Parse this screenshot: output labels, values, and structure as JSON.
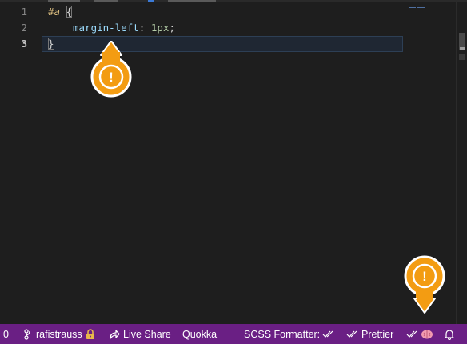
{
  "editor": {
    "line_numbers": [
      "1",
      "2",
      "3"
    ],
    "code": {
      "line1_selector": "#a",
      "line1_brace": "{",
      "line2_property": "margin-left",
      "line2_colon": ":",
      "line2_value": " 1px",
      "line2_semicolon": ";",
      "line3_brace": "}"
    },
    "active_line": 3
  },
  "statusbar": {
    "errors_count": "0",
    "account": "rafistrauss",
    "live_share": "Live Share",
    "quokka": "Quokka",
    "scss_formatter": "SCSS Formatter:",
    "prettier": "Prettier",
    "color": "#6a1f84"
  },
  "annotations": {
    "marker_symbol": "!",
    "marker_color": "#f39c12"
  },
  "icons": [
    "git-branch-icon",
    "lock-icon",
    "live-share-icon",
    "double-check-icon",
    "brain-icon",
    "bell-icon",
    "warning-marker-icon"
  ]
}
